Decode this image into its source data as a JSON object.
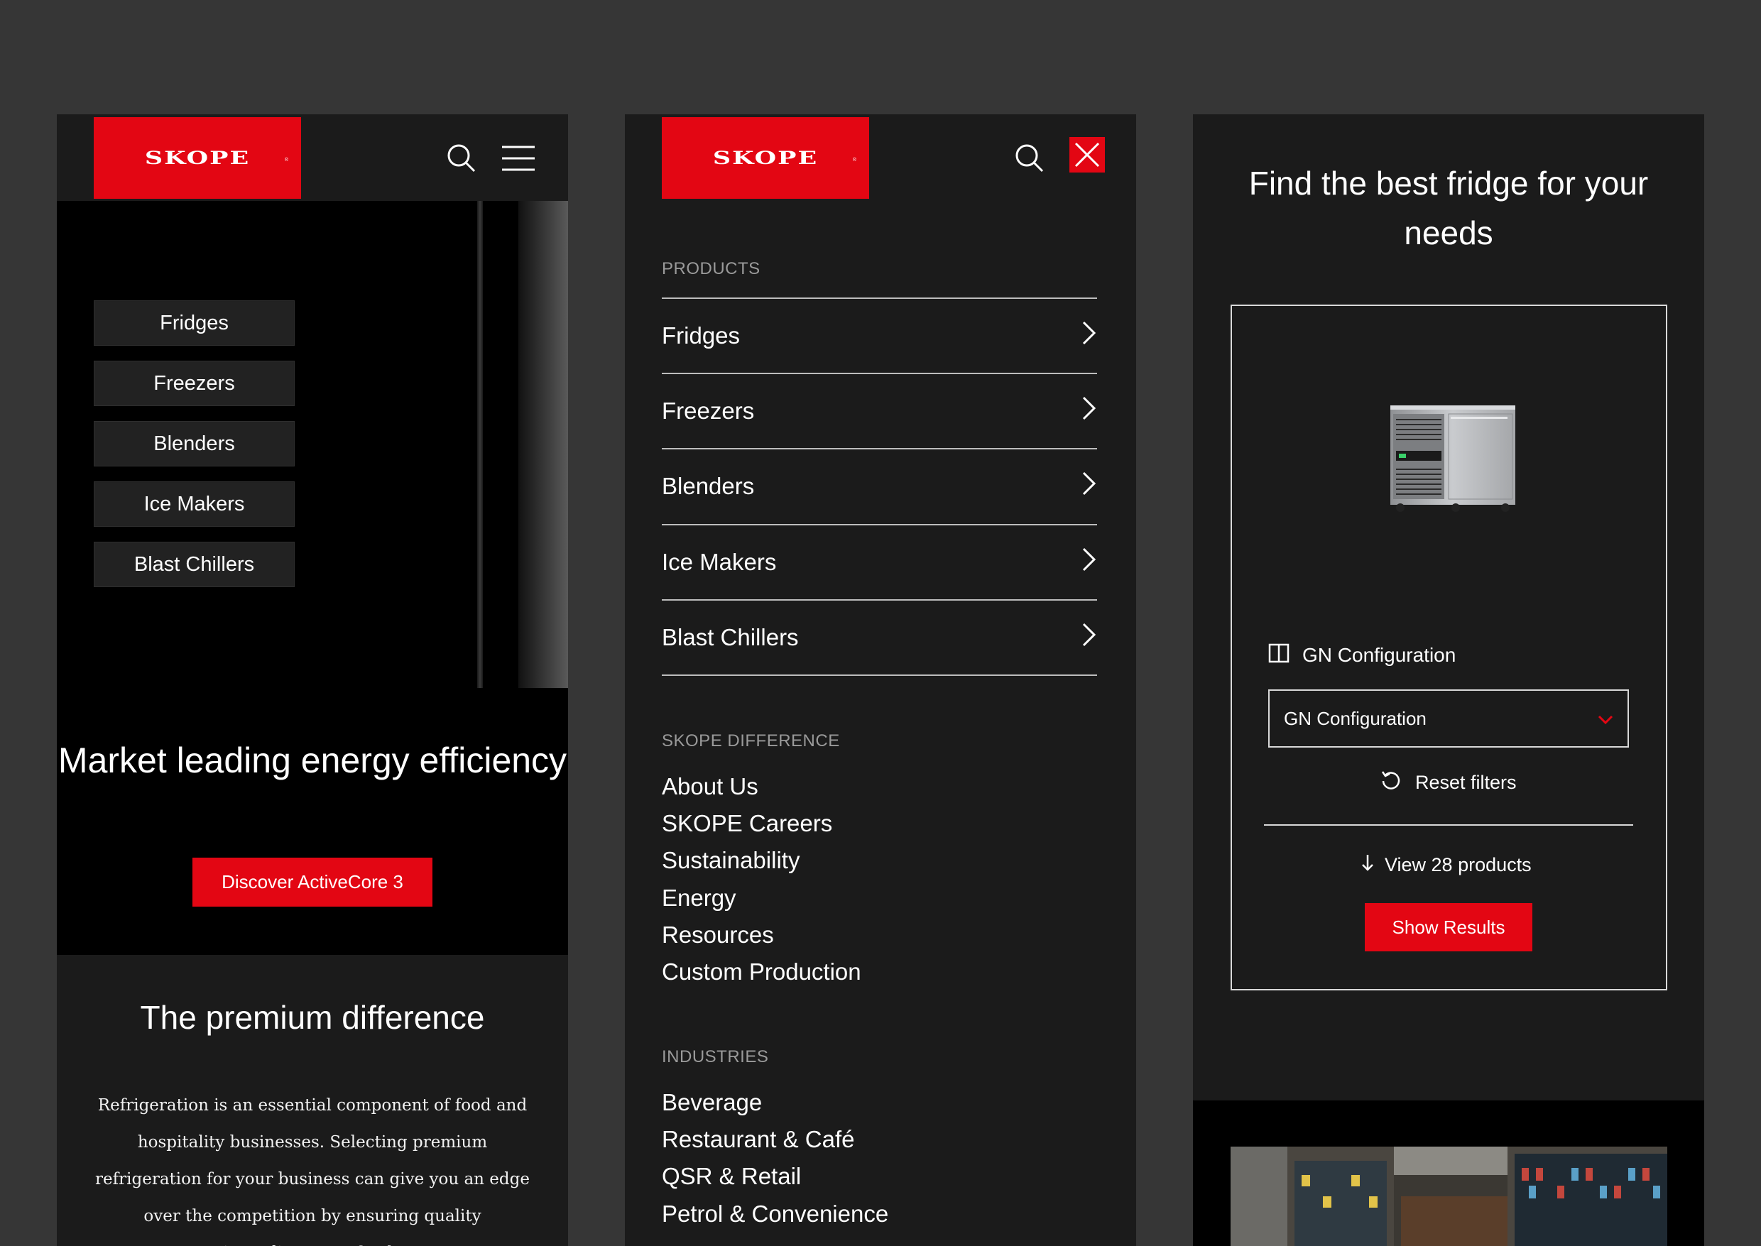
{
  "brand": {
    "logo_text": "SKOPE",
    "registered": "®",
    "accent": "#e30613"
  },
  "panel_home": {
    "icons": [
      "search-icon",
      "hamburger-menu-icon"
    ],
    "categories": [
      "Fridges",
      "Freezers",
      "Blenders",
      "Ice Makers",
      "Blast Chillers"
    ],
    "hero_title": "Market leading energy efficiency",
    "hero_cta": "Discover ActiveCore 3",
    "section_title": "The premium difference",
    "paragraph": "Refrigeration is an essential component of food and hospitality businesses. Selecting premium refrigeration for your business can give you an edge over the competition by ensuring quality ingredients, perfectly"
  },
  "panel_menu": {
    "icons": [
      "search-icon",
      "close-icon"
    ],
    "products_heading": "PRODUCTS",
    "products": [
      "Fridges",
      "Freezers",
      "Blenders",
      "Ice Makers",
      "Blast Chillers"
    ],
    "difference_heading": "SKOPE DIFFERENCE",
    "difference_links": [
      "About Us",
      "SKOPE Careers",
      "Sustainability",
      "Energy",
      "Resources",
      "Custom Production"
    ],
    "industries_heading": "INDUSTRIES",
    "industries_links": [
      "Beverage",
      "Restaurant & Café",
      "QSR & Retail",
      "Petrol & Convenience"
    ]
  },
  "panel_finder": {
    "title": "Find the best fridge for your needs",
    "filter_label": "GN Configuration",
    "select_value": "GN Configuration",
    "reset_label": "Reset filters",
    "view_label": "View 28 products",
    "show_results": "Show Results"
  }
}
